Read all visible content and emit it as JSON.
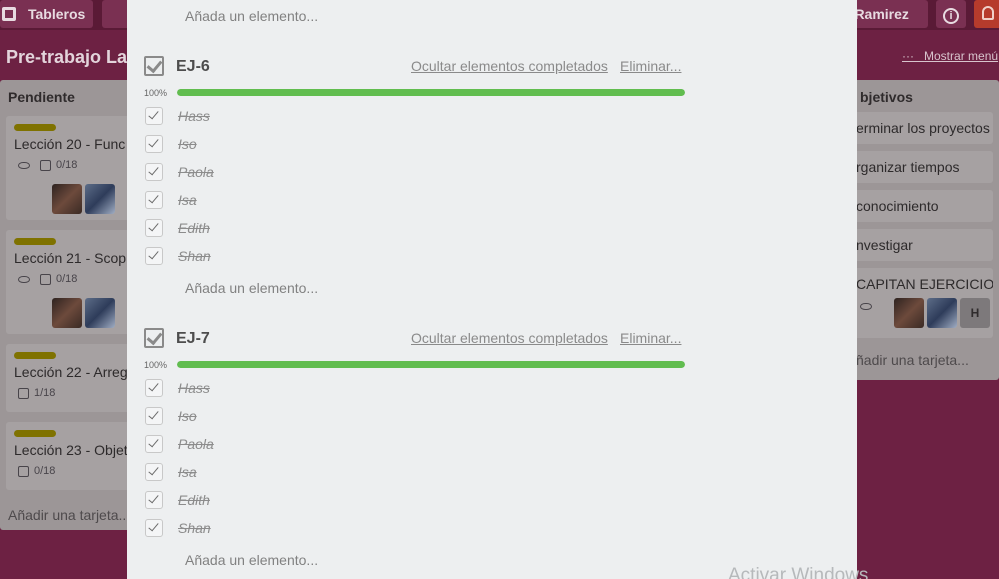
{
  "header": {
    "boards_label": "Tableros",
    "user_label": "n Ramirez",
    "info_glyph": "i"
  },
  "board": {
    "title": "Pre-trabajo La",
    "menu_dots": "···",
    "show_menu_label": "Mostrar menú"
  },
  "lists": {
    "left": {
      "name": "Pendiente",
      "cards": [
        {
          "title": "Lección 20 - Func",
          "badge": "0/18"
        },
        {
          "title": "Lección 21 - Scop",
          "badge": "0/18"
        },
        {
          "title": "Lección 22 - Arreg",
          "badge": "1/18"
        },
        {
          "title": "Lección 23 - Objet",
          "badge": "0/18"
        }
      ],
      "add_card": "Añadir una tarjeta..."
    },
    "right": {
      "name": "bjetivos",
      "cards": [
        {
          "title": "erminar los proyectos"
        },
        {
          "title": "rganizar tiempos"
        },
        {
          "title": "conocimiento"
        },
        {
          "title": "nvestigar"
        },
        {
          "title": "CAPITAN EJERCICIO",
          "avatar_letter": "H"
        }
      ],
      "add_card": "ñadir una tarjeta..."
    }
  },
  "modal": {
    "top_add_item": "Añada un elemento...",
    "checklists": [
      {
        "title": "EJ-6",
        "hide_completed": "Ocultar elementos completados",
        "delete": "Eliminar...",
        "progress_label": "100%",
        "progress": 1.0,
        "items": [
          "Hass",
          "Iso",
          "Paola",
          "Isa",
          "Edith",
          "Shan"
        ],
        "add_item": "Añada un elemento..."
      },
      {
        "title": "EJ-7",
        "hide_completed": "Ocultar elementos completados",
        "delete": "Eliminar...",
        "progress_label": "100%",
        "progress": 1.0,
        "items": [
          "Hass",
          "Iso",
          "Paola",
          "Isa",
          "Edith",
          "Shan"
        ],
        "add_item": "Añada un elemento..."
      }
    ]
  },
  "watermark": "Activar Windows",
  "colors": {
    "progress_fill": "#61bd4f",
    "label_yellow": "#f2d600",
    "board_background": "#89285b"
  }
}
